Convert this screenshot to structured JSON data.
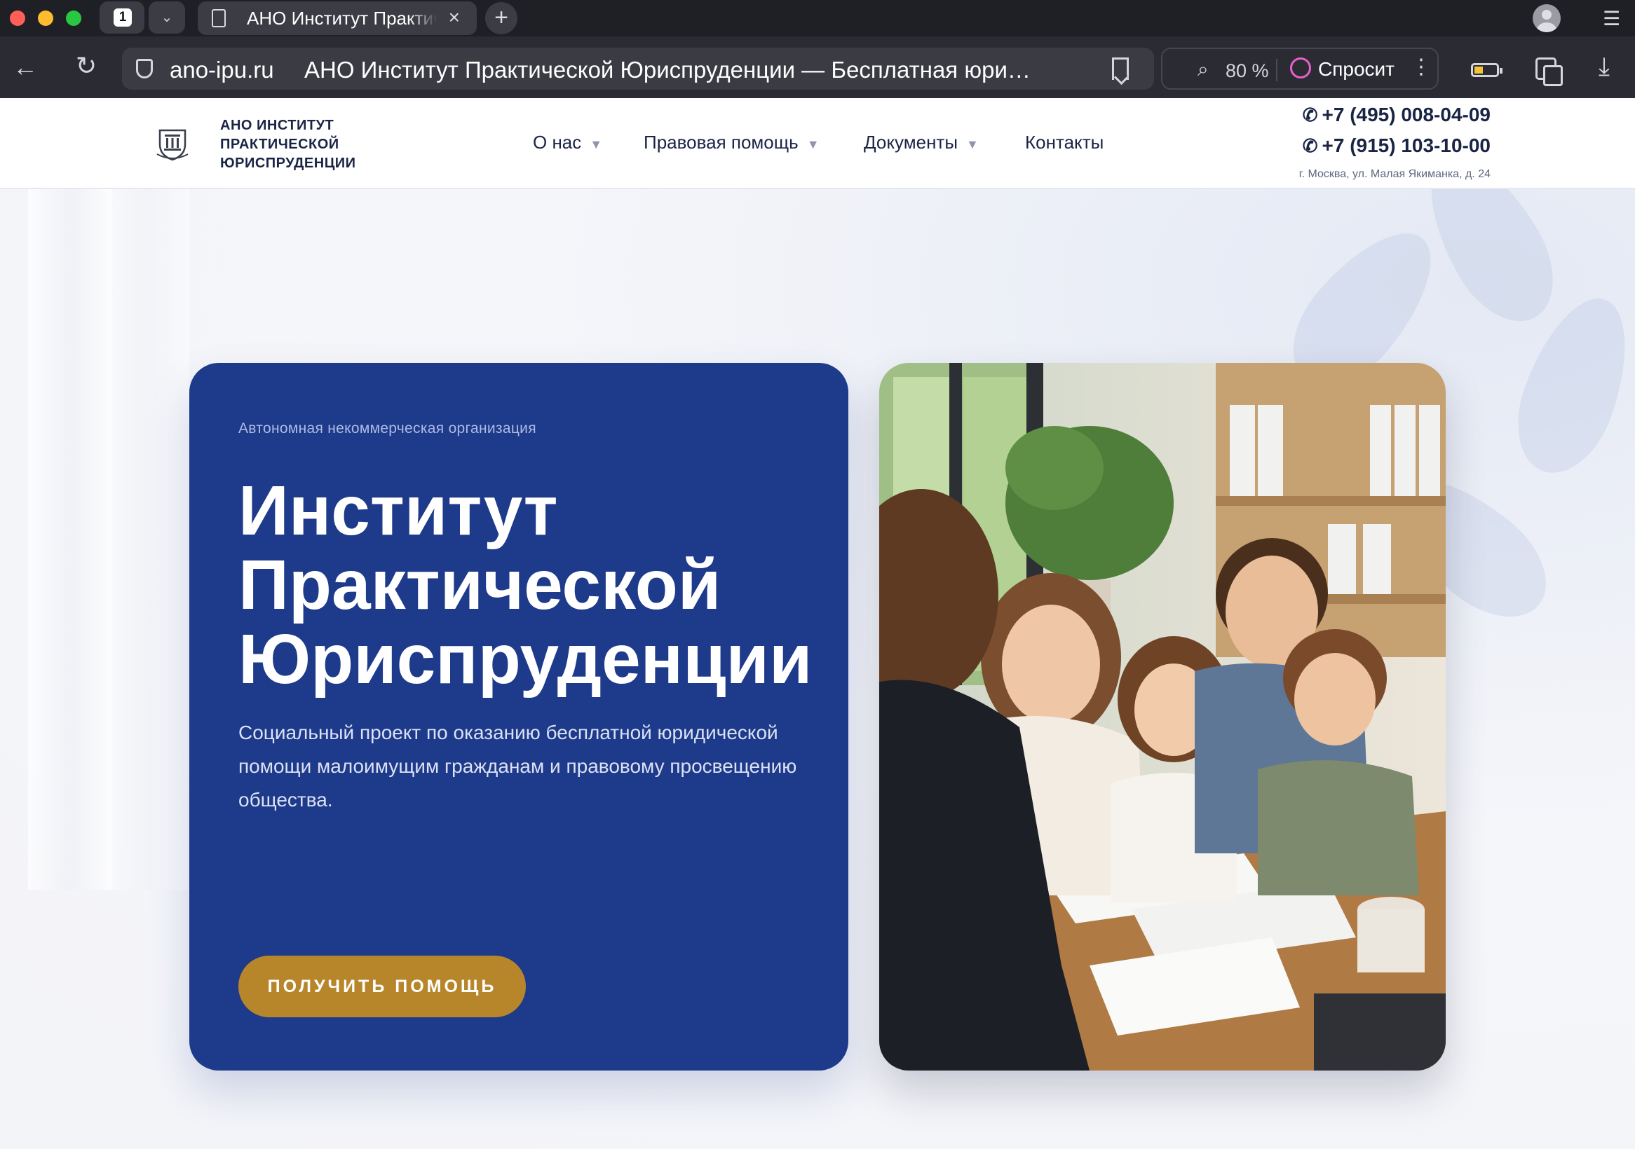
{
  "browser": {
    "tab_count": "1",
    "tab_title": "АНО Институт Практической Юриспруденции",
    "url_domain": "ano-ipu.ru",
    "page_title": "АНО Институт Практической Юриспруденции — Бесплатная юридич...",
    "zoom": "80 %",
    "ask_label": "Спросить"
  },
  "header": {
    "logo_lines": [
      "АНО ИНСТИТУТ",
      "ПРАКТИЧЕСКОЙ",
      "ЮРИСПРУДЕНЦИИ"
    ],
    "nav": [
      {
        "label": "О нас",
        "has_dropdown": true
      },
      {
        "label": "Правовая помощь",
        "has_dropdown": true
      },
      {
        "label": "Документы",
        "has_dropdown": true
      },
      {
        "label": "Контакты",
        "has_dropdown": false
      }
    ],
    "phones": [
      "+7 (495) 008-04-09",
      "+7 (915) 103-10-00"
    ],
    "address": "г. Москва, ул. Малая Якиманка, д. 24"
  },
  "hero": {
    "eyebrow": "Автономная некоммерческая организация",
    "title_lines": [
      "Институт",
      "Практической",
      "Юриспруденции"
    ],
    "description": "Социальный проект по оказанию бесплатной юридической помощи малоимущим гражданам и правовому просвещению общества.",
    "cta_label": "ПОЛУЧИТЬ ПОМОЩЬ"
  },
  "colors": {
    "brand_blue": "#1e3a8a",
    "accent_gold": "#b8862a",
    "text_dark": "#1a2545"
  },
  "icons": [
    "back-icon",
    "reload-icon",
    "shield-icon",
    "bookmark-icon",
    "zoom-icon",
    "ask-icon",
    "battery-icon",
    "copy-icon",
    "download-icon",
    "phone-icon",
    "document-icon",
    "close-icon",
    "plus-icon",
    "chevron-down-icon",
    "menu-icon",
    "avatar"
  ]
}
